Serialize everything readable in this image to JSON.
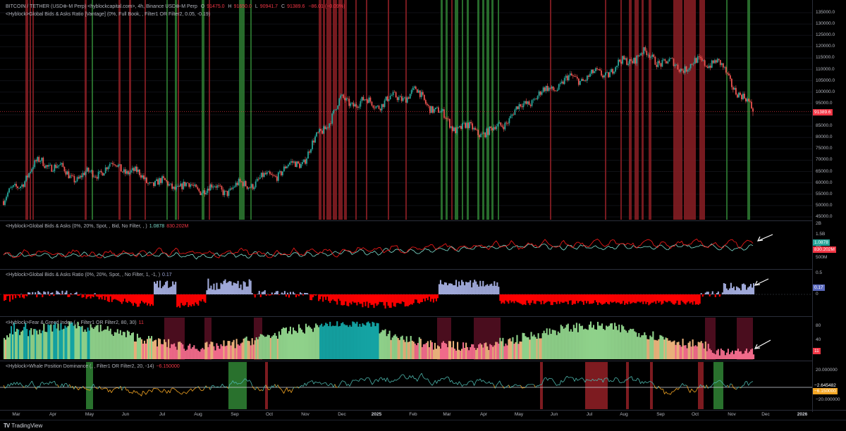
{
  "header": {
    "symbol": "BITCOIN / TETHER (USD⊕-M Perp) <hyblockcapital.com>, 4h, Binance USD⊕-M Perp",
    "o_label": "O",
    "o": "91475.0",
    "h_label": "H",
    "h": "91650.0",
    "l_label": "L",
    "l": "90941.7",
    "c_label": "C",
    "c": "91389.6",
    "change": "−86.01 (−0.09%)"
  },
  "panes": [
    {
      "title": "<Hyblock>Global Bids & Asks Ratio [Vantage] (0%, Full Book, , Filter1 OR Filter2, 0.05, -0.19)"
    },
    {
      "title": "<Hyblock>Global Bids & Asks (0%, 20%, Spot, , Bid, No Filter, , )",
      "value_a": "1.0878",
      "value_b": "830.202M"
    },
    {
      "title": "<Hyblock>Global Bids & Asks Ratio (0%, 20%, Spot, , No Filter, 1, -1, )",
      "value": "0.17"
    },
    {
      "title": "<Hyblock>Fear & Greed Index (, , Filter1 OR Filter2, 80, 30)",
      "value": "11"
    },
    {
      "title": "<Hyblock>Whale Position Dominance (, , Filter1 OR Filter2, 20, -14)",
      "value": "−6.150000"
    }
  ],
  "price_axis": {
    "ticks": [
      "135000.0",
      "130000.0",
      "125000.0",
      "120000.0",
      "115000.0",
      "110000.0",
      "105000.0",
      "100000.0",
      "95000.0",
      "90000.0",
      "85000.0",
      "80000.0",
      "75000.0",
      "70000.0",
      "65000.0",
      "60000.0",
      "55000.0",
      "50000.0",
      "45000.0"
    ],
    "last_price_label": "91389.6",
    "pane2_ticks": [
      "2B",
      "1.5B",
      "1B",
      "500M"
    ],
    "pane2_labels": [
      "1.0878",
      "830.202M"
    ],
    "pane3_ticks": [
      "0.5",
      "0"
    ],
    "pane3_label": "0.17",
    "pane4_ticks": [
      "80",
      "40"
    ],
    "pane4_label": "11",
    "pane5_ticks": [
      "20.000000",
      "−20.000000"
    ],
    "pane5_labels": [
      "−2.645482",
      "−6.150000"
    ]
  },
  "time_axis": {
    "ticks": [
      "Mar",
      "Apr",
      "May",
      "Jun",
      "Jul",
      "Aug",
      "Sep",
      "Oct",
      "Nov",
      "Dec",
      "2025",
      "Feb",
      "Mar",
      "Apr",
      "May",
      "Jun",
      "Jul",
      "Aug",
      "Sep",
      "Oct",
      "Nov",
      "Dec",
      "2026"
    ],
    "bold": [
      "2025",
      "2026"
    ]
  },
  "colors": {
    "bull": "#26a69a",
    "bear": "#ef5350",
    "red_band": "#8b1e24",
    "green_band": "#2e7d32",
    "bid_line": "#7fe0d0",
    "ask_line": "#ff1a1a",
    "ratio_pos": "#9fa8d8",
    "ratio_neg": "#ff0000",
    "fg_green": "#8fd18a",
    "fg_teal": "#14a3a3",
    "fg_orange": "#e8b07a",
    "fg_pink": "#f06a8a",
    "whale_teal": "#4db6ac",
    "whale_orange": "#f5a623"
  },
  "chart_data": {
    "type": "line",
    "title": "BITCOIN / TETHER (USD⊕-M Perp), 4h",
    "x": [
      "Mar 2024",
      "Apr",
      "May",
      "Jun",
      "Jul",
      "Aug",
      "Sep",
      "Oct",
      "Nov",
      "Dec",
      "Jan 2025",
      "Feb",
      "Mar",
      "Apr",
      "May",
      "Jun",
      "Jul",
      "Aug",
      "Sep",
      "Oct",
      "Nov"
    ],
    "series": [
      {
        "name": "BITCOIN / TETHER",
        "values": [
          52000,
          70000,
          62000,
          68000,
          60000,
          58000,
          57000,
          62000,
          70000,
          96000,
          95000,
          100000,
          85000,
          82000,
          96000,
          105000,
          108000,
          117000,
          111000,
          114000,
          91389.6
        ]
      }
    ],
    "ylim": [
      45000,
      135000
    ]
  },
  "footer": {
    "brand": "TradingView"
  }
}
